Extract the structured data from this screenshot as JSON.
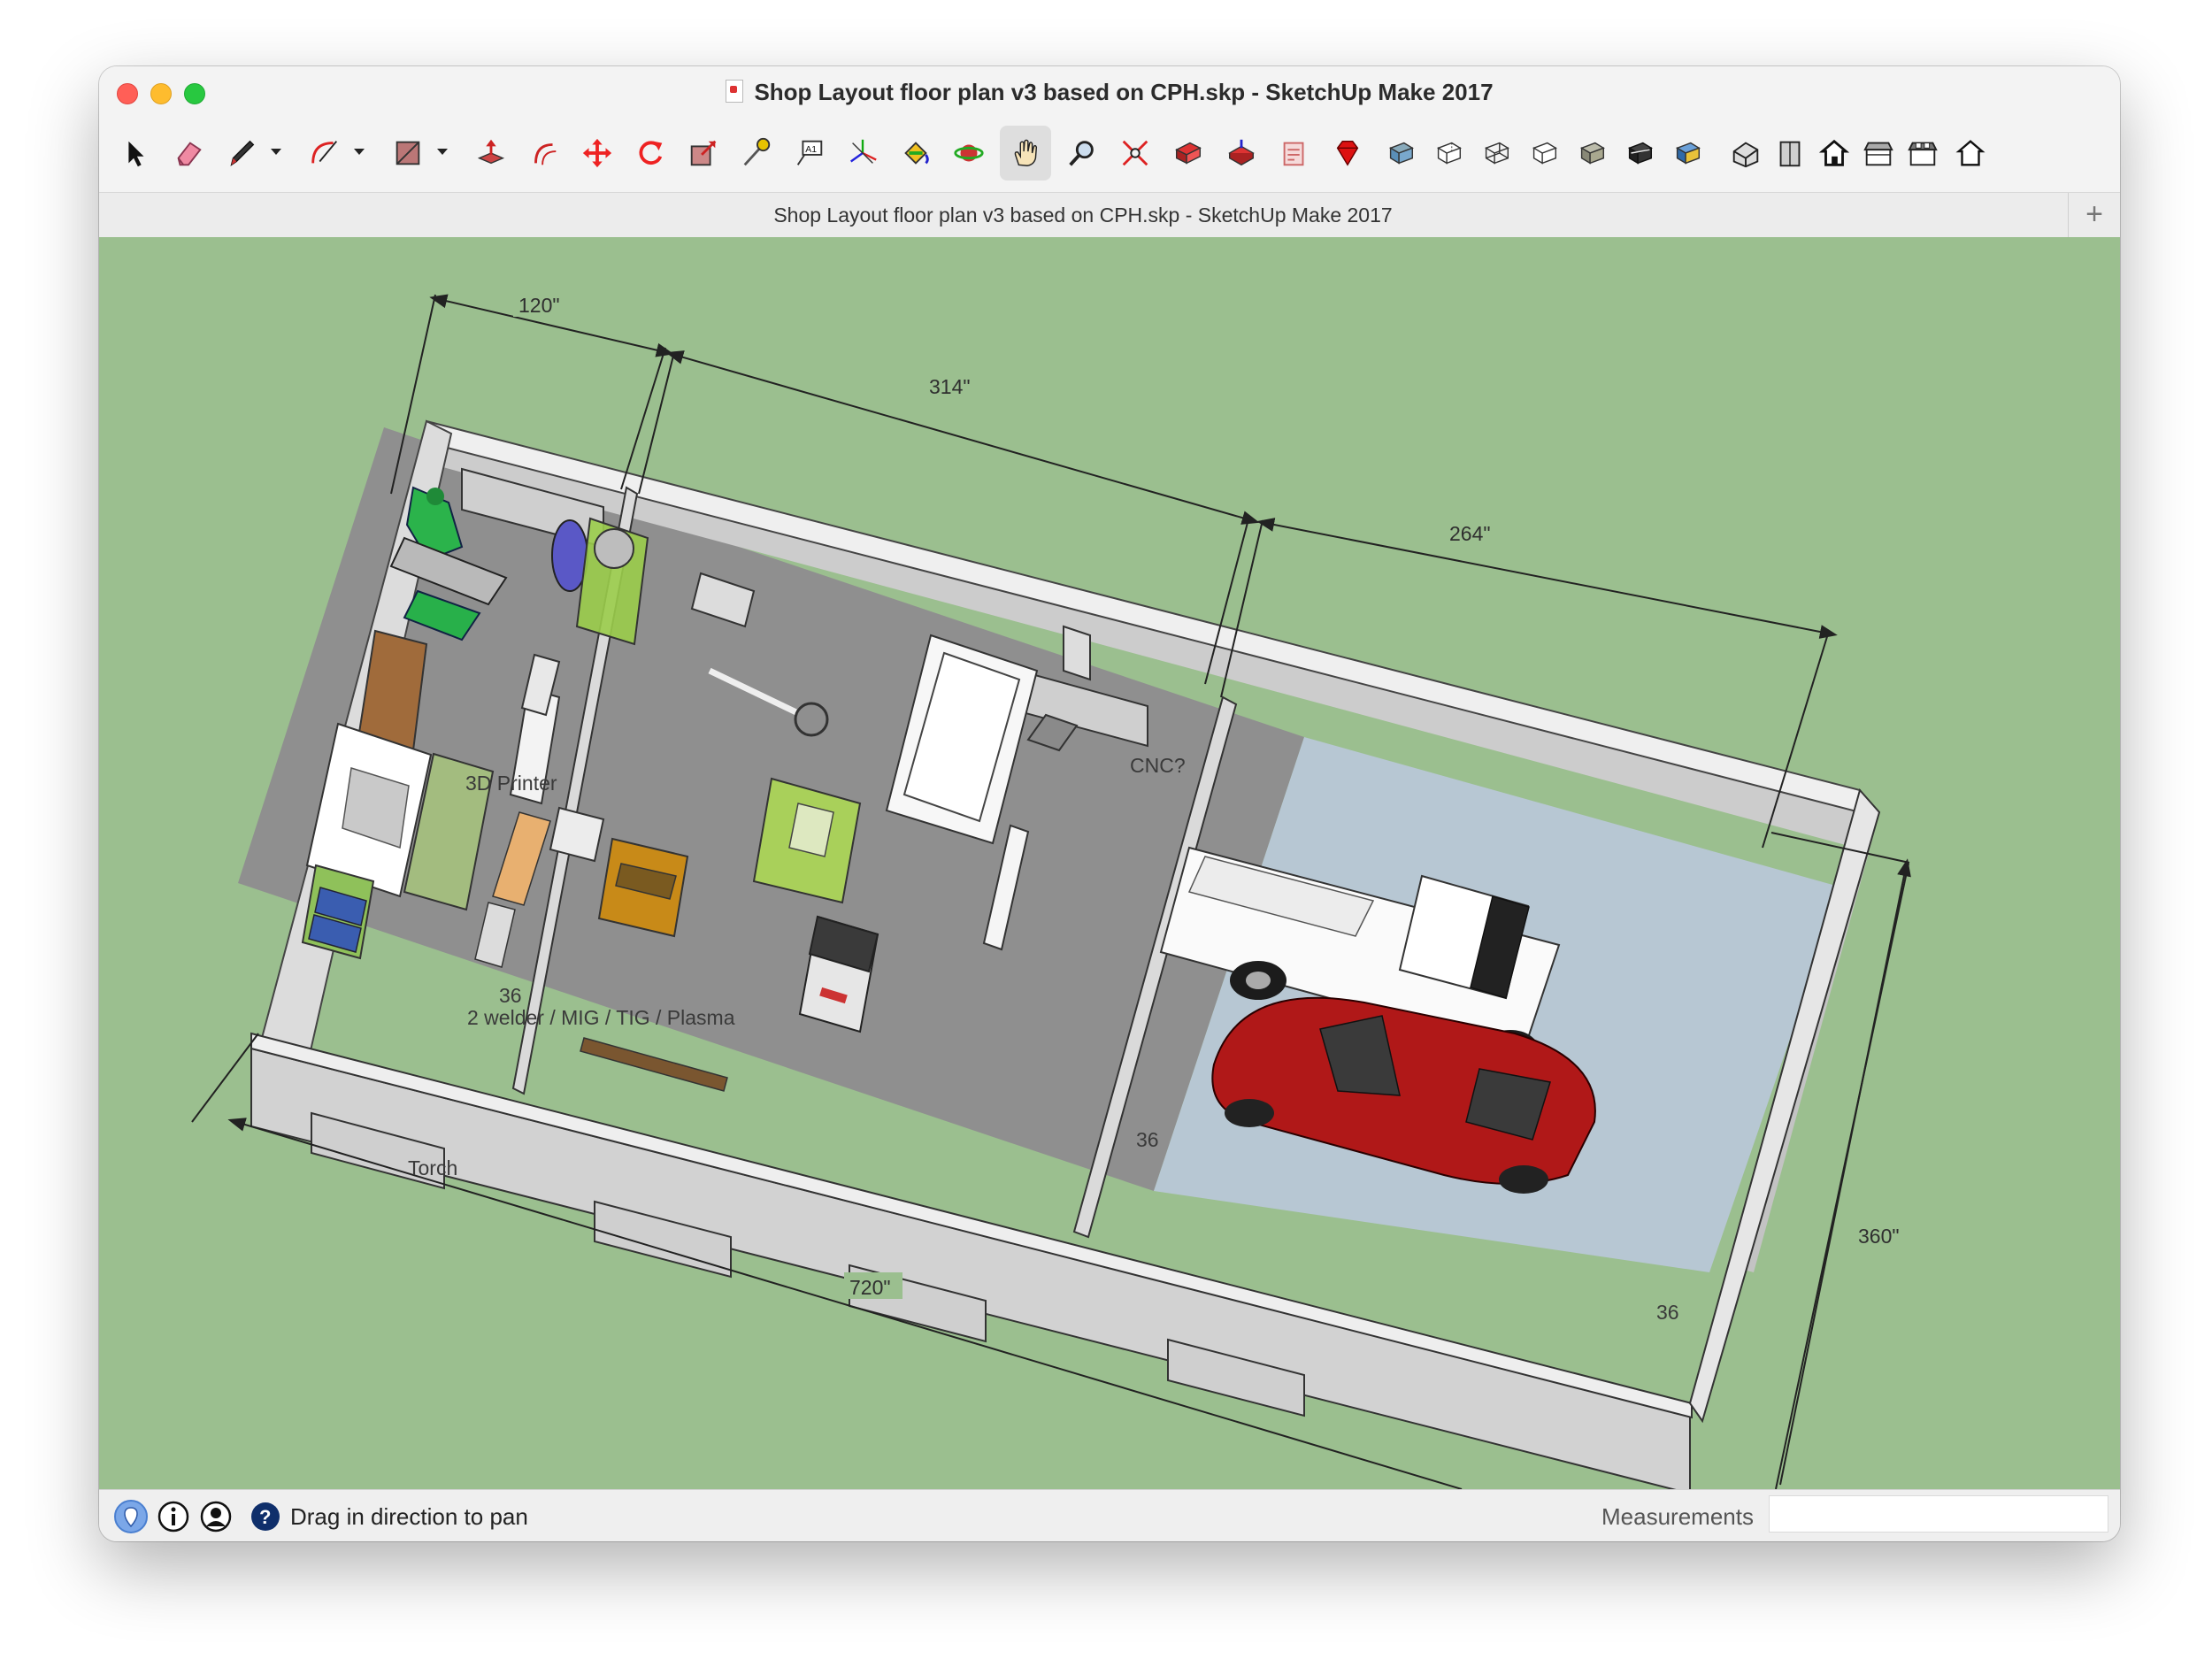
{
  "window": {
    "title": "Shop Layout floor plan v3 based on CPH.skp - SketchUp Make 2017"
  },
  "toolbar": {
    "tools": [
      {
        "name": "select-tool",
        "label": "Select"
      },
      {
        "name": "eraser-tool",
        "label": "Eraser"
      },
      {
        "name": "line-tool",
        "label": "Line"
      },
      {
        "name": "arc-tool",
        "label": "Arc"
      },
      {
        "name": "rectangle-tool",
        "label": "Rectangle"
      },
      {
        "name": "push-pull-tool",
        "label": "Push/Pull"
      },
      {
        "name": "offset-tool",
        "label": "Offset"
      },
      {
        "name": "move-tool",
        "label": "Move"
      },
      {
        "name": "rotate-tool",
        "label": "Rotate"
      },
      {
        "name": "scale-tool",
        "label": "Scale"
      },
      {
        "name": "tape-measure-tool",
        "label": "Tape Measure"
      },
      {
        "name": "text-tool",
        "label": "Text"
      },
      {
        "name": "axes-tool",
        "label": "Axes"
      },
      {
        "name": "paint-bucket-tool",
        "label": "Paint Bucket"
      },
      {
        "name": "orbit-tool",
        "label": "Orbit"
      },
      {
        "name": "pan-tool",
        "label": "Pan"
      },
      {
        "name": "zoom-tool",
        "label": "Zoom"
      },
      {
        "name": "zoom-extents-tool",
        "label": "Zoom Extents"
      },
      {
        "name": "warehouse-tool",
        "label": "3D Warehouse"
      },
      {
        "name": "share-model-tool",
        "label": "Share Model"
      },
      {
        "name": "layout-tool",
        "label": "Send to LayOut"
      },
      {
        "name": "extension-warehouse-tool",
        "label": "Extension Warehouse"
      },
      {
        "name": "xray-style-tool",
        "label": "X-Ray"
      },
      {
        "name": "back-edges-style-tool",
        "label": "Back Edges"
      },
      {
        "name": "wireframe-style-tool",
        "label": "Wireframe"
      },
      {
        "name": "hidden-line-style-tool",
        "label": "Hidden Line"
      },
      {
        "name": "shaded-style-tool",
        "label": "Shaded"
      },
      {
        "name": "shaded-textures-style-tool",
        "label": "Shaded With Textures"
      },
      {
        "name": "monochrome-style-tool",
        "label": "Monochrome"
      },
      {
        "name": "iso-view-tool",
        "label": "Iso"
      },
      {
        "name": "top-view-tool",
        "label": "Top"
      },
      {
        "name": "front-view-tool",
        "label": "Front"
      },
      {
        "name": "right-view-tool",
        "label": "Right"
      },
      {
        "name": "back-view-tool",
        "label": "Back"
      },
      {
        "name": "left-view-tool",
        "label": "Left"
      }
    ],
    "active_tool": "pan-tool"
  },
  "tabbar": {
    "title": "Shop Layout floor plan v3 based on CPH.skp - SketchUp Make 2017",
    "add_label": "+"
  },
  "model": {
    "dimensions": {
      "top_1": "120\"",
      "top_2": "314\"",
      "top_3": "264\"",
      "bottom": "720\"",
      "right": "360\""
    },
    "labels": {
      "printer": "3D Printer",
      "cnc": "CNC?",
      "welder": "2 welder / MIG / TIG / Plasma",
      "torch": "Torch",
      "door_height_1": "36",
      "door_height_2": "36",
      "door_height_3": "36"
    },
    "colors": {
      "ground": "#9bbf8f",
      "wall_top": "#e9e9e9",
      "wall_face": "#cfcfcf",
      "shop_floor": "#8e8e8e",
      "garage_floor": "#b7c7d3",
      "car_red": "#b01818",
      "truck_white": "#fafafa",
      "mill_green": "#27b24a",
      "cabinet_green": "#9acc4a"
    }
  },
  "statusbar": {
    "message": "Drag in direction to pan",
    "measurements_label": "Measurements",
    "measurements_value": ""
  }
}
